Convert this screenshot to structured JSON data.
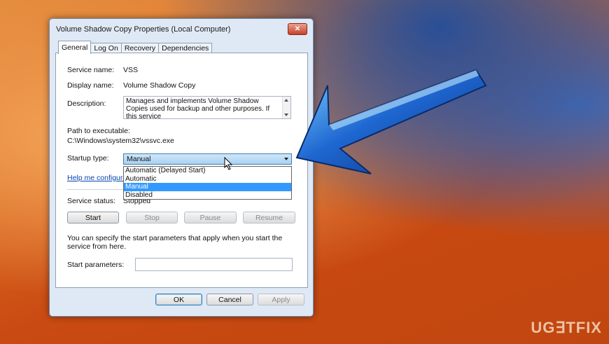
{
  "dialog": {
    "title": "Volume Shadow Copy Properties (Local Computer)",
    "close_glyph": "✕",
    "tabs": [
      "General",
      "Log On",
      "Recovery",
      "Dependencies"
    ]
  },
  "general": {
    "service_name_label": "Service name:",
    "service_name": "VSS",
    "display_name_label": "Display name:",
    "display_name": "Volume Shadow Copy",
    "description_label": "Description:",
    "description": "Manages and implements Volume Shadow Copies used for backup and other purposes. If this service",
    "path_label": "Path to executable:",
    "path": "C:\\Windows\\system32\\vssvc.exe",
    "startup_type_label": "Startup type:",
    "startup_type_value": "Manual",
    "startup_options": [
      "Automatic (Delayed Start)",
      "Automatic",
      "Manual",
      "Disabled"
    ],
    "help_link": "Help me configure",
    "service_status_label": "Service status:",
    "service_status": "Stopped",
    "buttons": {
      "start": "Start",
      "stop": "Stop",
      "pause": "Pause",
      "resume": "Resume"
    },
    "hint": "You can specify the start parameters that apply when you start the service from here.",
    "start_params_label": "Start parameters:",
    "start_params_value": ""
  },
  "footer": {
    "ok": "OK",
    "cancel": "Cancel",
    "apply": "Apply"
  },
  "watermark": "UG∃TFIX",
  "colors": {
    "selection": "#3399ff",
    "arrow": "#1f5fc4",
    "link": "#0645ad"
  }
}
